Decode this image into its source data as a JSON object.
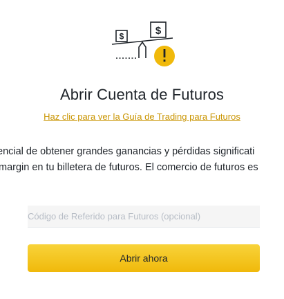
{
  "modal": {
    "title": "Abrir Cuenta de Futuros",
    "guide_link": "Haz clic para ver la Guía de Trading para Futuros",
    "risk_line_1": "encial de obtener grandes ganancias y pérdidas significati",
    "risk_line_2": "margin en tu billetera de futuros. El comercio de futuros es",
    "referral_placeholder": "Código de Referido para Futuros (opcional)",
    "open_button_label": "Abrir ahora"
  },
  "colors": {
    "accent": "#f0b90b",
    "link": "#c99400",
    "text": "#1e2329"
  },
  "icons": [
    "dollar-sign-icon",
    "warning-icon"
  ]
}
